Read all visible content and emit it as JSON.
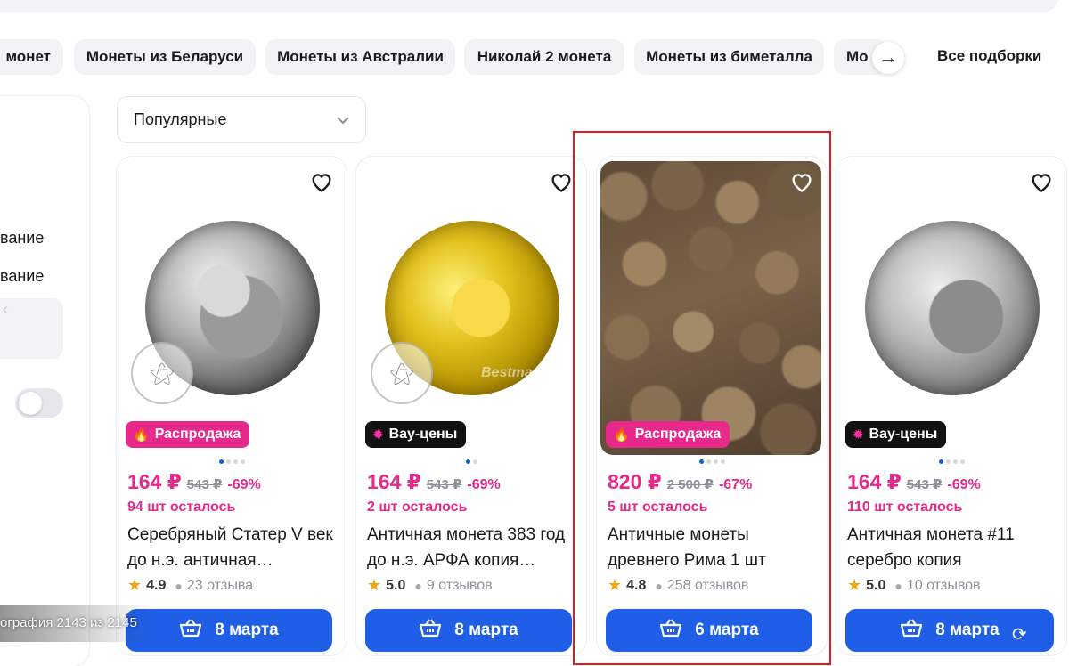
{
  "chips": {
    "items": [
      "монет",
      "Монеты из Беларуси",
      "Монеты из Австралии",
      "Николай 2 монета",
      "Монеты из биметалла",
      "Мо"
    ],
    "next_icon": "arrow-right-icon",
    "all_label": "Все подборки"
  },
  "filters": {
    "option1": "вание",
    "option2": "вание"
  },
  "sort": {
    "label": "Популярные",
    "icon": "chevron-down-icon"
  },
  "products": [
    {
      "image": "silver-coin",
      "badge": "Распродажа",
      "badge_type": "sale",
      "price": "164 ₽",
      "old_price": "543 ₽",
      "discount": "-69%",
      "stock": "94 шт осталось",
      "title": "Серебряный Статер V век до н.э. античная…",
      "rating": "4.9",
      "reviews": "23 отзыва",
      "delivery": "8 марта",
      "dots": 4,
      "active_dot": 0
    },
    {
      "image": "gold-coin",
      "badge": "Вау-цены",
      "badge_type": "wow",
      "price": "164 ₽",
      "old_price": "543 ₽",
      "discount": "-69%",
      "stock": "2 шт осталось",
      "title": "Античная монета 383 год до н.э. АРФА копия…",
      "rating": "5.0",
      "reviews": "9 отзывов",
      "delivery": "8 марта",
      "watermark_text": "Bestmani.ru",
      "dots": 2,
      "active_dot": 0
    },
    {
      "image": "coin-pile",
      "badge": "Распродажа",
      "badge_type": "sale",
      "price": "820 ₽",
      "old_price": "2 500 ₽",
      "discount": "-67%",
      "stock": "5 шт осталось",
      "title": "Античные монеты древнего Рима 1 шт",
      "rating": "4.8",
      "reviews": "258 отзывов",
      "delivery": "6 марта",
      "dots": 4,
      "active_dot": 0
    },
    {
      "image": "silver-coin-2",
      "badge": "Вау-цены",
      "badge_type": "wow",
      "price": "164 ₽",
      "old_price": "543 ₽",
      "discount": "-69%",
      "stock": "110 шт осталось",
      "title": "Античная монета #11 серебро копия",
      "rating": "5.0",
      "reviews": "10 отзывов",
      "delivery": "8 марта",
      "dots": 4,
      "active_dot": 0
    }
  ],
  "overlay": {
    "caption": "ография 2143 из 2145"
  },
  "colors": {
    "accent_pink": "#e6298a",
    "button_blue": "#1f5ee6",
    "highlight_red": "#e2191f"
  }
}
